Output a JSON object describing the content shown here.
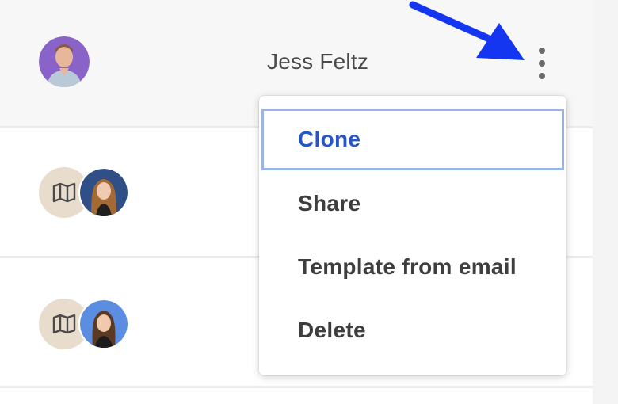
{
  "rows": [
    {
      "owner": "Jess Feltz"
    },
    {
      "owner": ""
    },
    {
      "owner": ""
    }
  ],
  "menu": {
    "items": [
      "Clone",
      "Share",
      "Template from email",
      "Delete"
    ]
  },
  "colors": {
    "highlight_text": "#2555c7",
    "highlight_border": "#9bb4e6",
    "annotation_arrow": "#1436f0",
    "badge_bg": "#e8dccd"
  },
  "icons": {
    "row_menu": "more-vertical-icon",
    "template_badge": "map-flag-icon",
    "annotation": "arrow-icon"
  }
}
